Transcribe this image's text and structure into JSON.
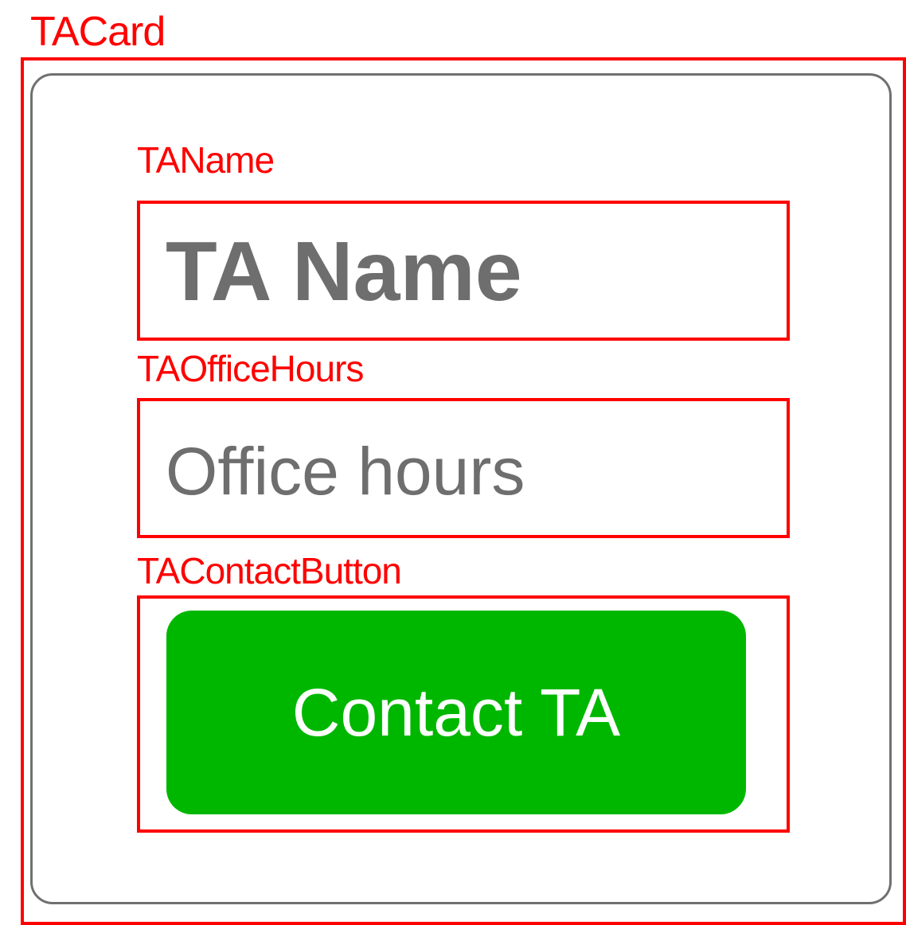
{
  "annotations": {
    "card": "TACard",
    "name": "TAName",
    "office_hours": "TAOfficeHours",
    "contact_button": "TAContactButton"
  },
  "card": {
    "name_text": "TA Name",
    "office_hours_text": "Office hours",
    "contact_button_label": "Contact TA"
  },
  "colors": {
    "annotation": "#ff0000",
    "card_border": "#707070",
    "text_gray": "#6e6e6e",
    "button_green": "#00b700",
    "button_text": "#ffffff"
  }
}
